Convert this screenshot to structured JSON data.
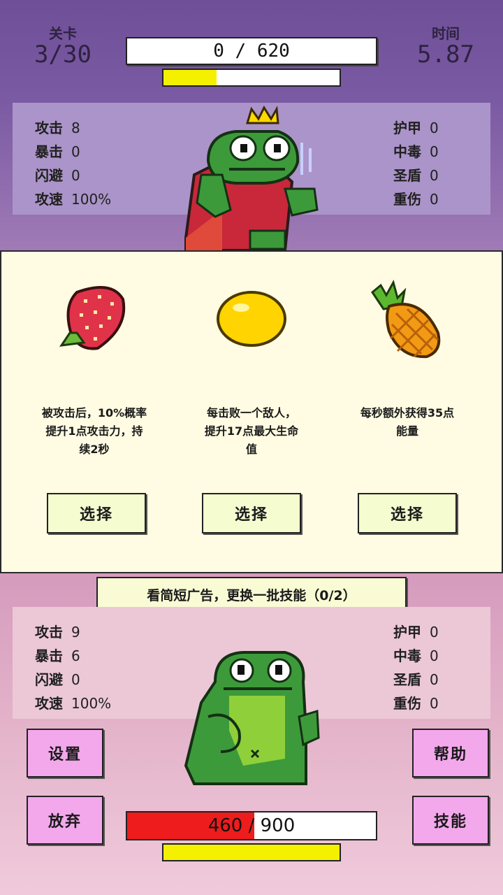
{
  "hud": {
    "level_label": "关卡",
    "level_value": "3/30",
    "time_label": "时间",
    "time_value": "5.87",
    "enemy_hp_text": "0 / 620",
    "enemy_energy_fraction": 0.3
  },
  "enemy_stats": {
    "left": [
      {
        "label": "攻击",
        "value": "8"
      },
      {
        "label": "暴击",
        "value": "0"
      },
      {
        "label": "闪避",
        "value": "0"
      },
      {
        "label": "攻速",
        "value": "100%"
      }
    ],
    "right": [
      {
        "label": "护甲",
        "value": "0"
      },
      {
        "label": "中毒",
        "value": "0"
      },
      {
        "label": "圣盾",
        "value": "0"
      },
      {
        "label": "重伤",
        "value": "0"
      }
    ]
  },
  "skills": [
    {
      "icon": "strawberry-icon",
      "desc": [
        "被攻击后，10%概率",
        "提升1点攻击力，持",
        "续2秒"
      ],
      "button": "选择"
    },
    {
      "icon": "lemon-icon",
      "desc": [
        "每击败一个敌人，",
        "提升17点最大生命",
        "值"
      ],
      "button": "选择"
    },
    {
      "icon": "pineapple-icon",
      "desc": [
        "每秒额外获得35点",
        "能量"
      ],
      "button": "选择"
    }
  ],
  "ad_banner": "看简短广告，更换一批技能（0/2）",
  "player_stats": {
    "left": [
      {
        "label": "攻击",
        "value": "9"
      },
      {
        "label": "暴击",
        "value": "6"
      },
      {
        "label": "闪避",
        "value": "0"
      },
      {
        "label": "攻速",
        "value": "100%"
      }
    ],
    "right": [
      {
        "label": "护甲",
        "value": "0"
      },
      {
        "label": "中毒",
        "value": "0"
      },
      {
        "label": "圣盾",
        "value": "0"
      },
      {
        "label": "重伤",
        "value": "0"
      }
    ]
  },
  "buttons": {
    "settings": "设置",
    "help": "帮助",
    "give_up": "放弃",
    "skills": "技能"
  },
  "player_hp": {
    "current": "460",
    "max": "900",
    "separator": "/",
    "fraction": 0.511
  },
  "player_energy_fraction": 1.0,
  "colors": {
    "top_bg": "#6f4f98",
    "card_bg": "#fffce3",
    "energy": "#f4f000",
    "hp": "#ee1c1c",
    "pink_button": "#f3a8ec"
  }
}
